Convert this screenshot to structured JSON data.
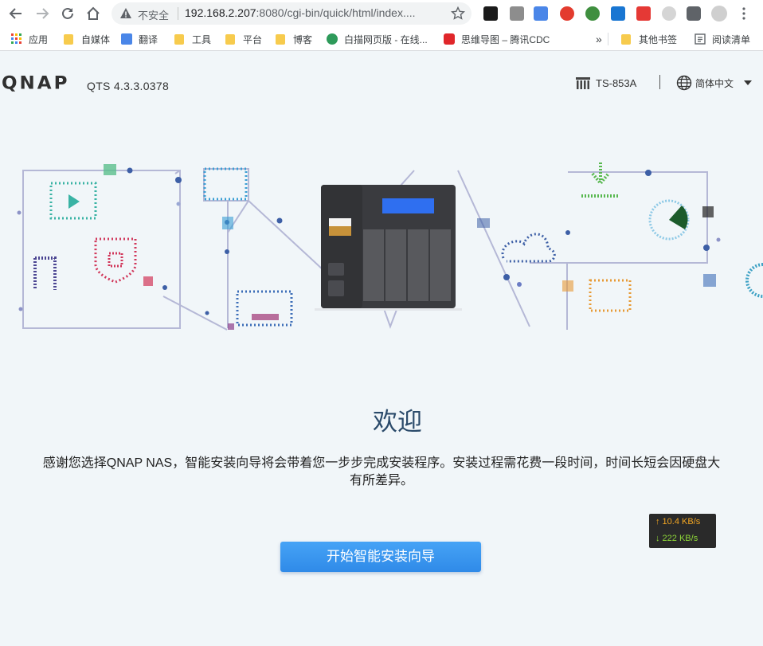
{
  "browser": {
    "insecure_label": "不安全",
    "url_host": "192.168.2.207",
    "url_rest": ":8080/cgi-bin/quick/html/index....",
    "bookmarks": [
      {
        "label": "应用"
      },
      {
        "label": "自媒体"
      },
      {
        "label": "翻译"
      },
      {
        "label": "工具"
      },
      {
        "label": "平台"
      },
      {
        "label": "博客"
      },
      {
        "label": "白描网页版 - 在线..."
      },
      {
        "label": "思维导图 – 腾讯CDC"
      }
    ],
    "more_label": "»",
    "other_bookmarks": "其他书签",
    "reading_list": "阅读清单"
  },
  "header": {
    "logo": "QNAP",
    "version": "QTS 4.3.3.0378",
    "model": "TS-853A",
    "language": "简体中文"
  },
  "main": {
    "welcome": "欢迎",
    "description_line1": "感谢您选择QNAP NAS，智能安装向导将会带着您一步步完成安装程序。安装过程需花费一段时间，时间长短会因硬盘大",
    "description_line2": "有所差异。",
    "start_button": "开始智能安装向导"
  },
  "speed": {
    "up": "↑ 10.4 KB/s",
    "down": "↓ 222 KB/s"
  }
}
